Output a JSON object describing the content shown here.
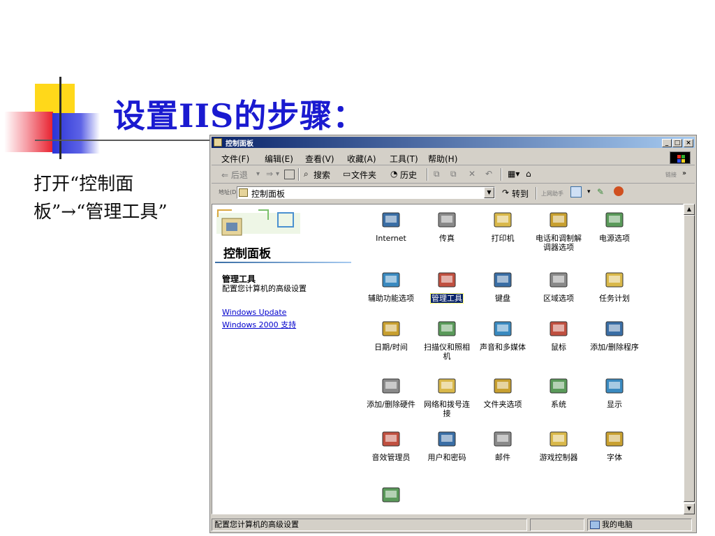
{
  "slide": {
    "title": "设置IIS的步骤：",
    "body": "打开“控制面板”→“管理工具”"
  },
  "window": {
    "title": "控制面板",
    "menu": [
      "文件(F)",
      "编辑(E)",
      "查看(V)",
      "收藏(A)",
      "工具(T)",
      "帮助(H)"
    ],
    "toolbar": {
      "back": "⇐ 后退",
      "forward": "⇒",
      "search": "搜索",
      "folders": "文件夹",
      "history": "历史",
      "links": "链接"
    },
    "address": {
      "label": "地址(D)",
      "value": "控制面板",
      "go": "转到",
      "assistant": "上网助手"
    },
    "panel": {
      "title": "控制面板",
      "selected_title": "管理工具",
      "selected_desc": "配置您计算机的高级设置",
      "links": [
        "Windows Update",
        "Windows 2000 支持"
      ]
    },
    "icons": [
      {
        "label": "Internet",
        "icon": "internet-options-icon"
      },
      {
        "label": "传真",
        "icon": "fax-icon"
      },
      {
        "label": "打印机",
        "icon": "printers-icon"
      },
      {
        "label": "电话和调制解调器选项",
        "icon": "phone-modem-icon"
      },
      {
        "label": "电源选项",
        "icon": "power-options-icon"
      },
      {
        "label": "辅助功能选项",
        "icon": "accessibility-icon"
      },
      {
        "label": "管理工具",
        "icon": "admin-tools-icon",
        "selected": true
      },
      {
        "label": "键盘",
        "icon": "keyboard-icon"
      },
      {
        "label": "区域选项",
        "icon": "regional-options-icon"
      },
      {
        "label": "任务计划",
        "icon": "scheduled-tasks-icon"
      },
      {
        "label": "日期/时间",
        "icon": "date-time-icon"
      },
      {
        "label": "扫描仪和照相机",
        "icon": "scanner-camera-icon"
      },
      {
        "label": "声音和多媒体",
        "icon": "sound-multimedia-icon"
      },
      {
        "label": "鼠标",
        "icon": "mouse-icon"
      },
      {
        "label": "添加/删除程序",
        "icon": "add-remove-programs-icon"
      },
      {
        "label": "添加/删除硬件",
        "icon": "add-remove-hardware-icon"
      },
      {
        "label": "网络和拨号连接",
        "icon": "network-dialup-icon"
      },
      {
        "label": "文件夹选项",
        "icon": "folder-options-icon"
      },
      {
        "label": "系统",
        "icon": "system-icon"
      },
      {
        "label": "显示",
        "icon": "display-icon"
      },
      {
        "label": "音效管理员",
        "icon": "sound-manager-icon"
      },
      {
        "label": "用户和密码",
        "icon": "users-passwords-icon"
      },
      {
        "label": "邮件",
        "icon": "mail-icon"
      },
      {
        "label": "游戏控制器",
        "icon": "game-controllers-icon"
      },
      {
        "label": "字体",
        "icon": "fonts-icon"
      },
      {
        "label": "",
        "icon": "windows-update-icon"
      }
    ],
    "status": {
      "text": "配置您计算机的高级设置",
      "zone": "我的电脑"
    }
  }
}
